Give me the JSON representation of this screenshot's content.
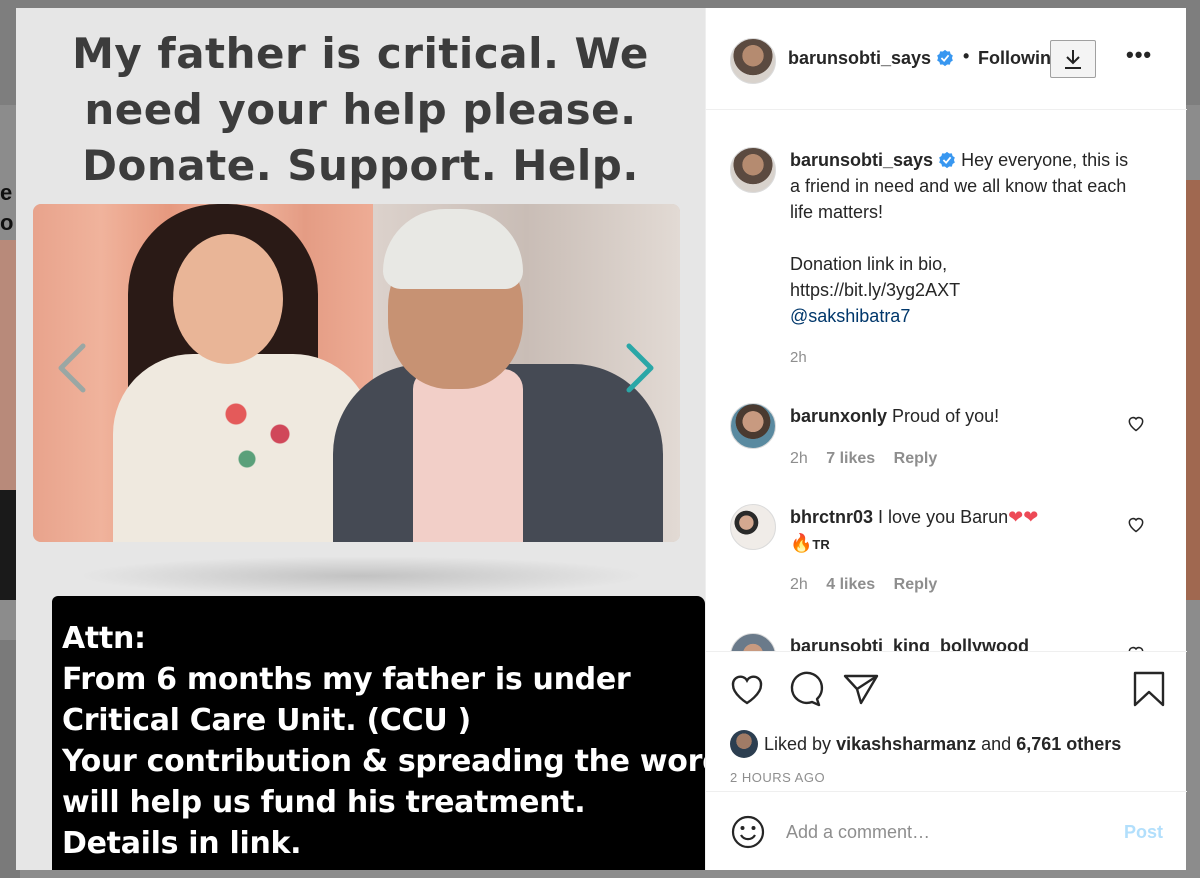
{
  "post": {
    "headline_lines": [
      "My father is critical. We",
      "need your help please.",
      "Donate. Support. Help."
    ],
    "attn_lines": [
      "Attn:",
      "From 6 months my father is under",
      "Critical Care Unit. (CCU )",
      "Your contribution & spreading the word",
      "will help us fund his treatment.",
      "Details in link."
    ]
  },
  "header": {
    "username": "barunsobti_says",
    "follow_label": "Following",
    "dot": "•",
    "more_icon": "more-options-icon"
  },
  "caption": {
    "username": "barunsobti_says",
    "text": "Hey everyone, this is a friend in need and we all know that each life matters!",
    "donation_text": "Donation link in bio,",
    "link": "https://bit.ly/3yg2AXT",
    "mention": "@sakshibatra7",
    "time": "2h"
  },
  "comments": [
    {
      "username": "barunxonly",
      "text": "Proud of you!",
      "time": "2h",
      "likes": "7 likes",
      "reply": "Reply"
    },
    {
      "username": "bhrctnr03",
      "text": "I love you Barun",
      "emojis": "❤❤",
      "line2_emoji": "🔥",
      "line2_text": "TR",
      "time": "2h",
      "likes": "4 likes",
      "reply": "Reply"
    },
    {
      "username": "barunsobti_king_bollywood"
    }
  ],
  "likes": {
    "prefix": "Liked by",
    "user": "vikashsharmanz",
    "and": "and",
    "others": "6,761 others"
  },
  "timestamp": "2 HOURS AGO",
  "comment_box": {
    "placeholder": "Add a comment…",
    "post_label": "Post"
  },
  "colors": {
    "verified": "#3897f0",
    "link": "#00376b",
    "post_disabled": "#b2dffc",
    "heart_red": "#ed4956"
  },
  "background_fragments": [
    "e",
    "o"
  ]
}
